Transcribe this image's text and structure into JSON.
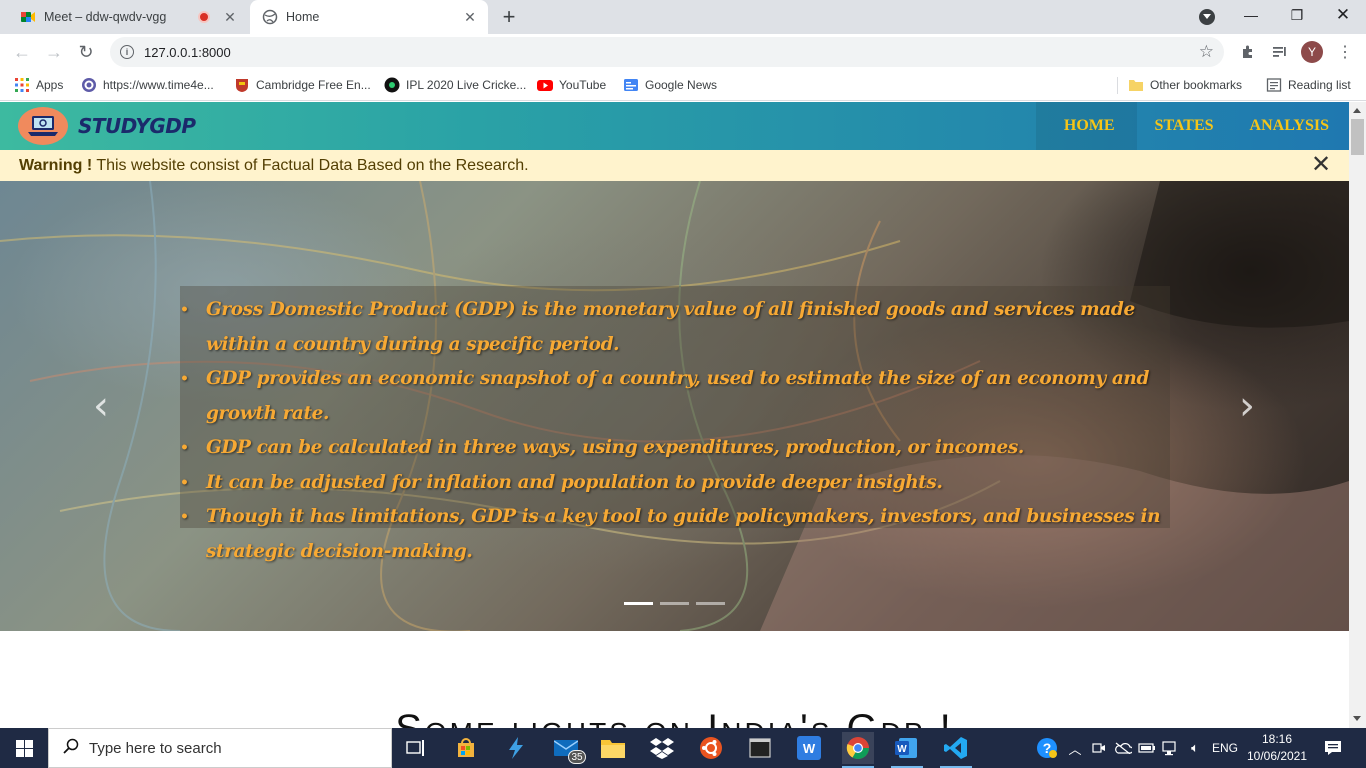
{
  "browser": {
    "tabs": [
      {
        "title": "Meet – ddw-qwdv-vgg",
        "active": false,
        "recording": true
      },
      {
        "title": "Home",
        "active": true
      }
    ],
    "new_tab_label": "+",
    "url": "127.0.0.1:8000",
    "profile_initial": "Y",
    "bookmarks": [
      {
        "label": "Apps",
        "icon": "apps-grid-icon"
      },
      {
        "label": "https://www.time4e...",
        "icon": "globe-icon"
      },
      {
        "label": "Cambridge Free En...",
        "icon": "cambridge-icon"
      },
      {
        "label": "IPL 2020 Live Cricke...",
        "icon": "cricket-icon"
      },
      {
        "label": "YouTube",
        "icon": "youtube-icon"
      },
      {
        "label": "Google News",
        "icon": "google-news-icon"
      }
    ],
    "other_bookmarks": "Other bookmarks",
    "reading_list": "Reading list"
  },
  "site": {
    "brand": "STUDYGDP",
    "nav": [
      "HOME",
      "STATES",
      "ANALYSIS"
    ],
    "active_nav": "HOME",
    "alert": {
      "strong": "Warning !",
      "text": " This website consist of Factual Data Based on the Research."
    },
    "carousel": {
      "bullets": [
        "Gross Domestic Product (GDP) is the monetary value of all finished goods and services made within a country    during a specific period.",
        "GDP provides an economic snapshot of a country, used to estimate the size of an economy and growth rate.",
        "GDP can be calculated in three ways, using expenditures, production, or incomes.",
        "It can be adjusted for inflation and population to provide deeper insights.",
        "Though it has limitations, GDP is a key tool to guide policymakers, investors, and businesses in strategic decision-making."
      ],
      "slide_count": 3,
      "active_slide": 1
    },
    "section_heading": "Some lights on India's Gdp !"
  },
  "taskbar": {
    "search_placeholder": "Type here to search",
    "mail_badge": "35",
    "language": "ENG",
    "time": "18:16",
    "date": "10/06/2021"
  },
  "colors": {
    "accent_gold": "#f5c518",
    "caption_orange": "#f7a934",
    "alert_bg": "#fff3cd"
  }
}
